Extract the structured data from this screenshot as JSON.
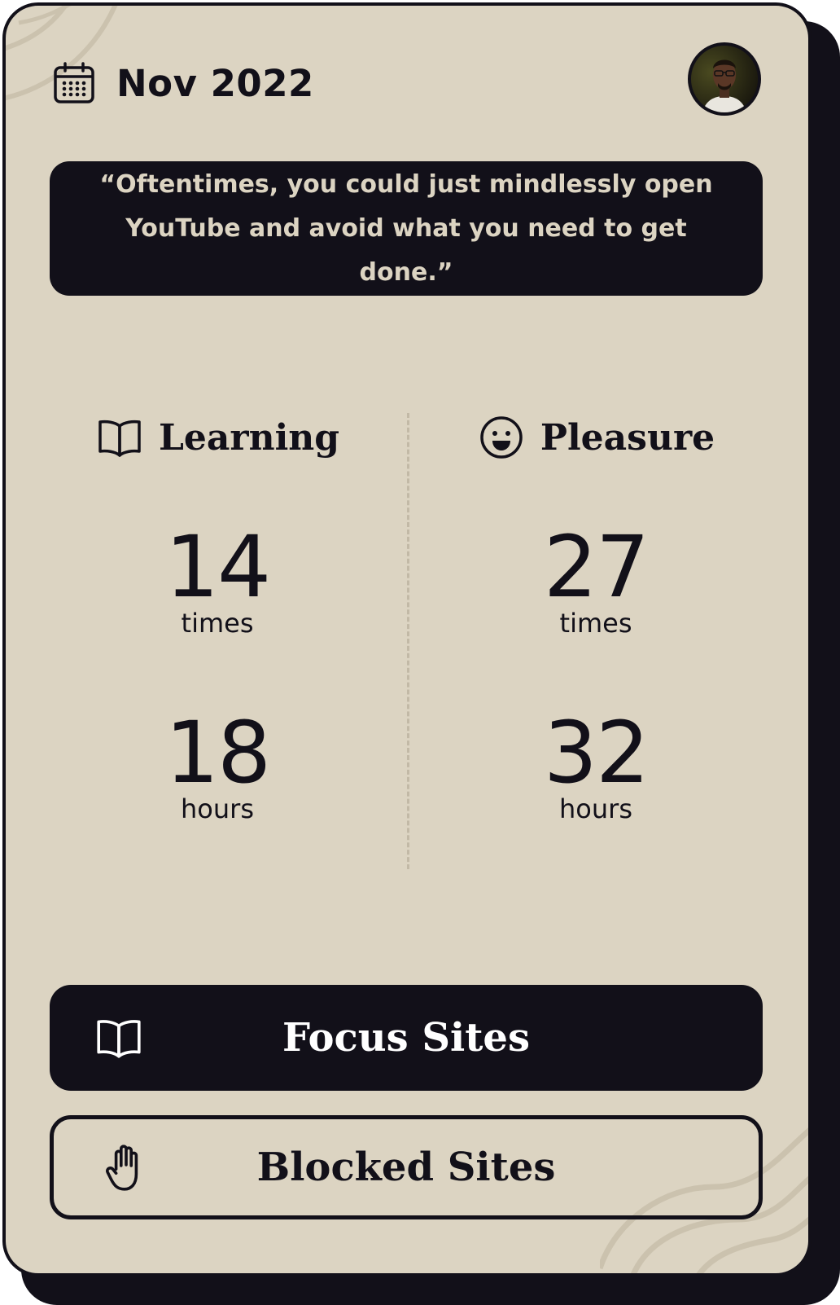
{
  "header": {
    "month": "Nov 2022",
    "calendar_icon": "calendar-icon",
    "avatar_icon": "user-avatar"
  },
  "quote": {
    "text": "“Oftentimes, you could just mindlessly open YouTube and avoid what you need to get done.”"
  },
  "stats": {
    "learning": {
      "label": "Learning",
      "icon": "book-open-icon",
      "times_value": "14",
      "times_unit": "times",
      "hours_value": "18",
      "hours_unit": "hours"
    },
    "pleasure": {
      "label": "Pleasure",
      "icon": "smile-icon",
      "times_value": "27",
      "times_unit": "times",
      "hours_value": "32",
      "hours_unit": "hours"
    }
  },
  "buttons": {
    "focus": {
      "label": "Focus Sites",
      "icon": "book-open-icon"
    },
    "blocked": {
      "label": "Blocked Sites",
      "icon": "hand-stop-icon"
    }
  },
  "colors": {
    "background": "#dcd4c2",
    "ink": "#121019",
    "divider": "#c2b9a6"
  }
}
